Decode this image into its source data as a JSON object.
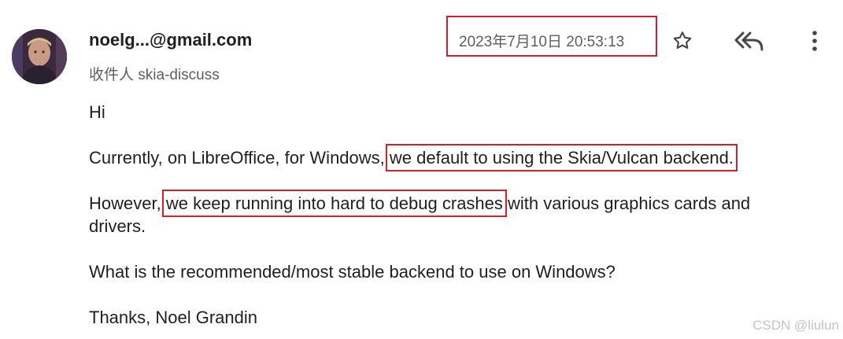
{
  "email": {
    "sender": "noelg...@gmail.com",
    "recipient": "收件人 skia-discuss",
    "datetime": "2023年7月10日 20:53:13"
  },
  "actions": {
    "star_icon": "star-icon",
    "reply_all_icon": "reply-all-icon",
    "more_icon": "more-vertical-icon"
  },
  "body": {
    "greeting": "Hi",
    "p2_prefix": "Currently, on LibreOffice, for Windows, ",
    "p2_highlight": "we default to using the Skia/Vulcan backend.",
    "p3_prefix": "However, ",
    "p3_highlight": "we keep running into hard to debug crashes",
    "p3_suffix": " with various graphics cards and",
    "p3_line2": "drivers.",
    "p4": "What is the recommended/most stable backend to use on Windows?",
    "signoff": "Thanks, Noel Grandin"
  },
  "watermark": "CSDN @liulun",
  "colors": {
    "highlight_border": "#d0202a",
    "muted_text": "#5e5e5e",
    "body_text": "#1f1f1f"
  }
}
